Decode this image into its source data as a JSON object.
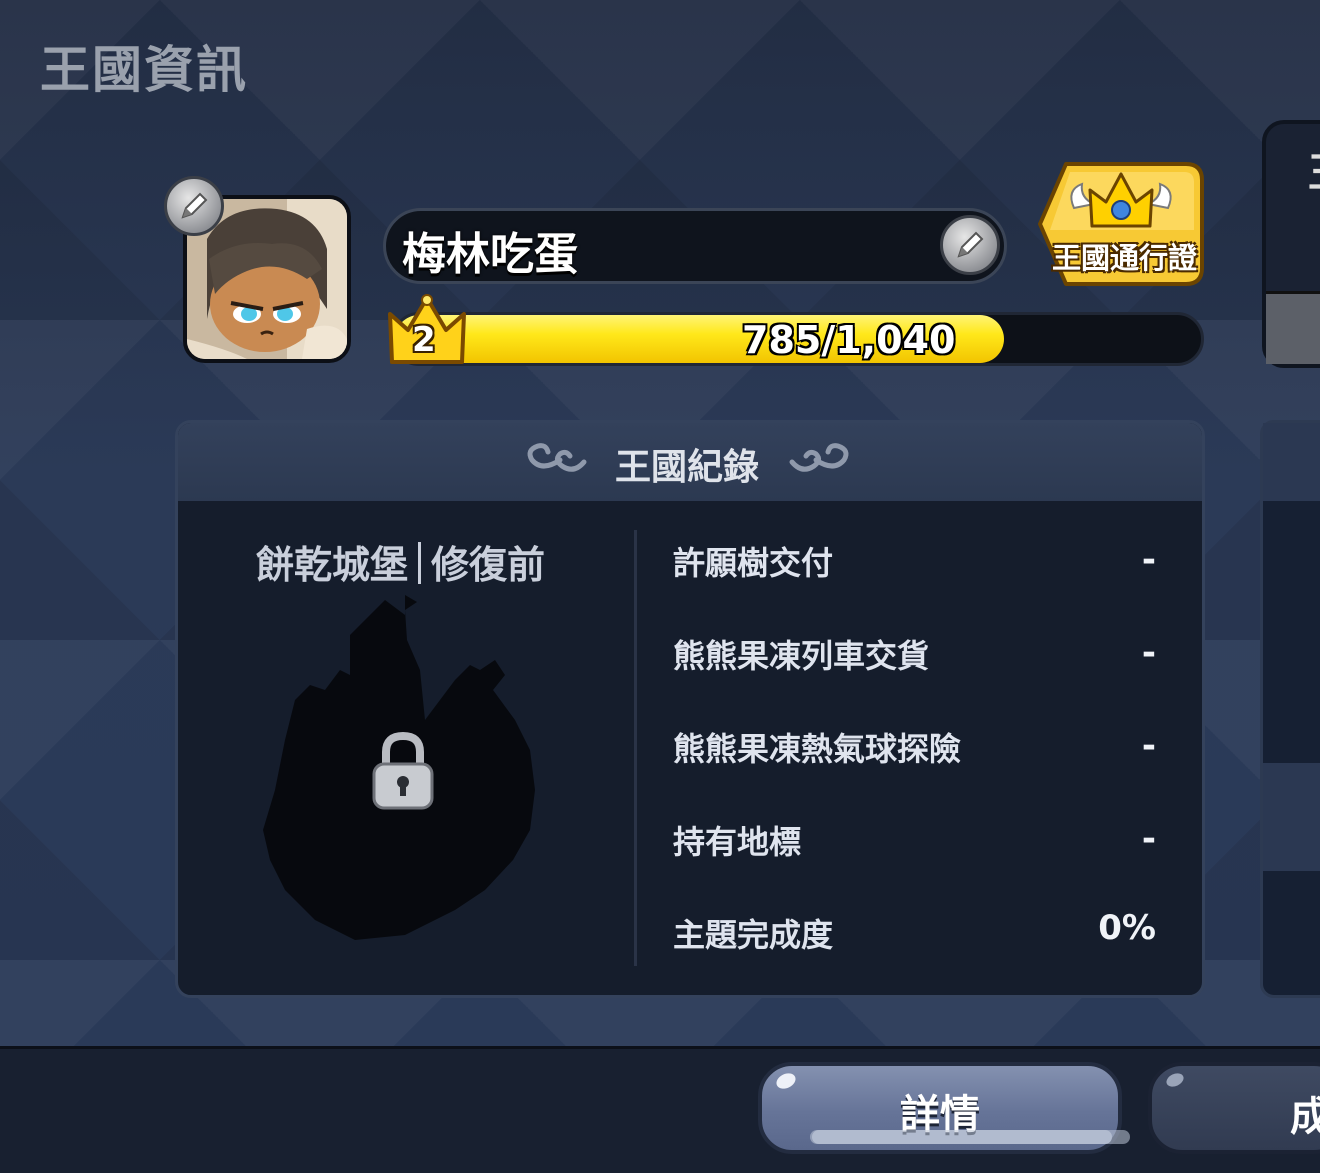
{
  "header": {
    "title": "王國資訊"
  },
  "profile": {
    "name": "梅林吃蛋",
    "level": "2",
    "xp_text": "785/1,040",
    "xp_fraction": 0.755,
    "avatar_icon": "cookie-avatar-icon",
    "edit_icon": "pencil-icon"
  },
  "pass": {
    "label": "王國通行證",
    "icon": "winged-crown-icon"
  },
  "records": {
    "title": "王國紀錄",
    "castle_name": "餅乾城堡",
    "castle_status": "修復前",
    "items": [
      {
        "label": "許願樹交付",
        "value": "-"
      },
      {
        "label": "熊熊果凍列車交貨",
        "value": "-"
      },
      {
        "label": "熊熊果凍熱氣球探險",
        "value": "-"
      },
      {
        "label": "持有地標",
        "value": "-"
      },
      {
        "label": "主題完成度",
        "value": "0%"
      }
    ]
  },
  "side": {
    "partial_glyph": "王"
  },
  "bottom": {
    "detail_label": "詳情",
    "achievement_label": "成"
  },
  "colors": {
    "xp_fill": "#ffe81a",
    "panel": "#151d2c",
    "background": "#26334d"
  }
}
